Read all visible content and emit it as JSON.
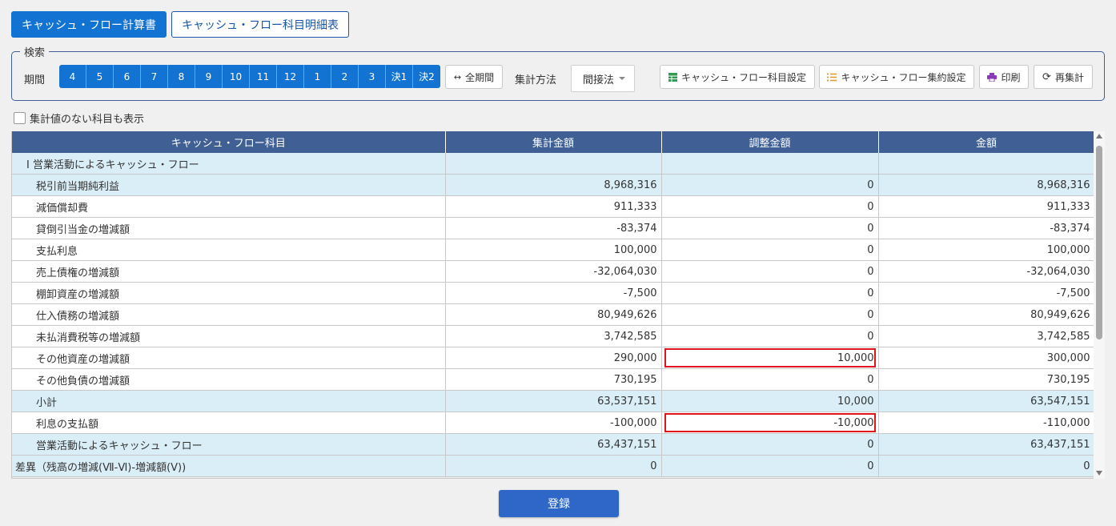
{
  "tabs": {
    "active": "キャッシュ・フロー計算書",
    "inactive": "キャッシュ・フロー科目明細表"
  },
  "search": {
    "legend": "検索",
    "period_label": "期間",
    "months": [
      "4",
      "5",
      "6",
      "7",
      "8",
      "9",
      "10",
      "11",
      "12",
      "1",
      "2",
      "3",
      "決1",
      "決2"
    ],
    "all_period": "全期間",
    "method_label": "集計方法",
    "method_value": "間接法",
    "btn_item_settings": "キャッシュ・フロー科目設定",
    "btn_aggregate_settings": "キャッシュ・フロー集約設定",
    "btn_print": "印刷",
    "btn_recalc": "再集計"
  },
  "show_empty_label": "集計値のない科目も表示",
  "table": {
    "headers": [
      "キャッシュ・フロー科目",
      "集計金額",
      "調整金額",
      "金額"
    ],
    "rows": [
      {
        "name": "Ⅰ 営業活動によるキャッシュ・フロー",
        "agg": "",
        "adj": "",
        "amt": ""
      },
      {
        "name": "税引前当期純利益",
        "agg": "8,968,316",
        "adj": "0",
        "amt": "8,968,316"
      },
      {
        "name": "減価償却費",
        "agg": "911,333",
        "adj": "0",
        "amt": "911,333"
      },
      {
        "name": "貸倒引当金の増減額",
        "agg": "-83,374",
        "adj": "0",
        "amt": "-83,374"
      },
      {
        "name": "支払利息",
        "agg": "100,000",
        "adj": "0",
        "amt": "100,000"
      },
      {
        "name": "売上債権の増減額",
        "agg": "-32,064,030",
        "adj": "0",
        "amt": "-32,064,030"
      },
      {
        "name": "棚卸資産の増減額",
        "agg": "-7,500",
        "adj": "0",
        "amt": "-7,500"
      },
      {
        "name": "仕入債務の増減額",
        "agg": "80,949,626",
        "adj": "0",
        "amt": "80,949,626"
      },
      {
        "name": "未払消費税等の増減額",
        "agg": "3,742,585",
        "adj": "0",
        "amt": "3,742,585"
      },
      {
        "name": "その他資産の増減額",
        "agg": "290,000",
        "adj": "10,000",
        "amt": "300,000"
      },
      {
        "name": "その他負債の増減額",
        "agg": "730,195",
        "adj": "0",
        "amt": "730,195"
      },
      {
        "name": "小計",
        "agg": "63,537,151",
        "adj": "10,000",
        "amt": "63,547,151"
      },
      {
        "name": "利息の支払額",
        "agg": "-100,000",
        "adj": "-10,000",
        "amt": "-110,000"
      },
      {
        "name": "営業活動によるキャッシュ・フロー",
        "agg": "63,437,151",
        "adj": "0",
        "amt": "63,437,151"
      },
      {
        "name": "差異（残高の増減(Ⅶ-Ⅵ)-増減額(Ⅴ))",
        "agg": "0",
        "adj": "0",
        "amt": "0"
      }
    ]
  },
  "register_label": "登録"
}
